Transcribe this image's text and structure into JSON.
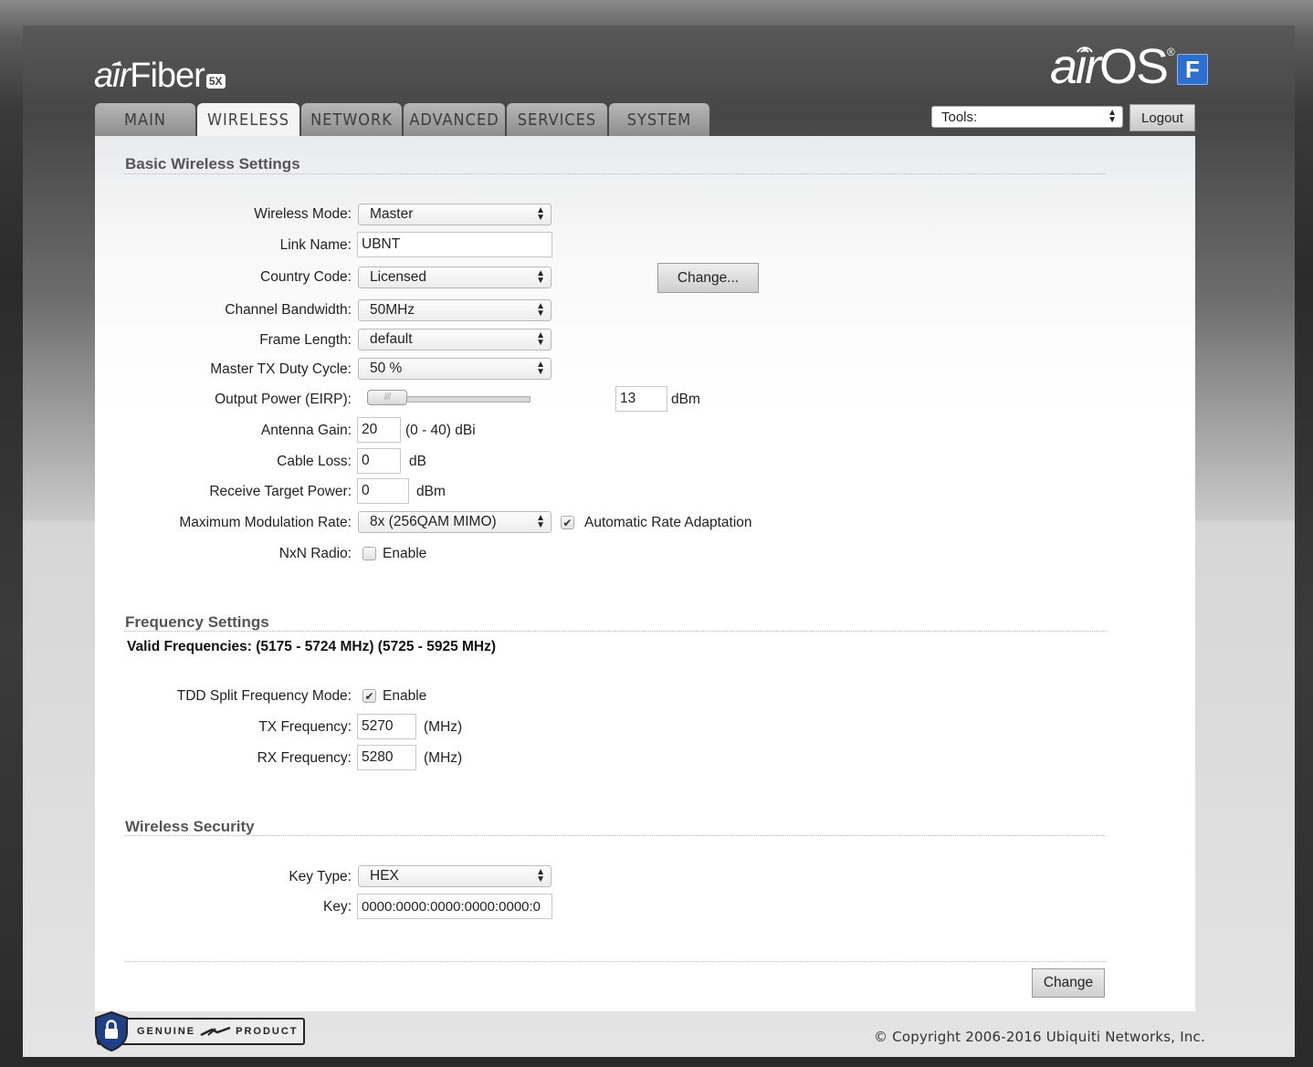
{
  "brand": {
    "product_air": "air",
    "product_name": "Fiber",
    "product_badge": "5X",
    "os_air": "air",
    "os_name": "OS",
    "os_reg": "®",
    "os_badge": "F"
  },
  "tabs": [
    {
      "label": "MAIN"
    },
    {
      "label": "WIRELESS"
    },
    {
      "label": "NETWORK"
    },
    {
      "label": "ADVANCED"
    },
    {
      "label": "SERVICES"
    },
    {
      "label": "SYSTEM"
    }
  ],
  "header": {
    "tools_value": "Tools:",
    "logout_label": "Logout"
  },
  "basic": {
    "title": "Basic Wireless Settings",
    "wireless_mode_label": "Wireless Mode:",
    "wireless_mode_value": "Master",
    "link_name_label": "Link Name:",
    "link_name_value": "UBNT",
    "country_code_label": "Country Code:",
    "country_code_value": "Licensed",
    "change_country_label": "Change...",
    "channel_bw_label": "Channel Bandwidth:",
    "channel_bw_value": "50MHz",
    "frame_length_label": "Frame Length:",
    "frame_length_value": "default",
    "duty_cycle_label": "Master TX Duty Cycle:",
    "duty_cycle_value": "50 %",
    "output_power_label": "Output Power (EIRP):",
    "output_power_value": "13",
    "output_power_unit": "dBm",
    "antenna_gain_label": "Antenna Gain:",
    "antenna_gain_value": "20",
    "antenna_gain_range": "(0 - 40) dBi",
    "cable_loss_label": "Cable Loss:",
    "cable_loss_value": "0",
    "cable_loss_unit": "dB",
    "rx_target_label": "Receive Target Power:",
    "rx_target_value": "0",
    "rx_target_unit": "dBm",
    "max_mod_label": "Maximum Modulation Rate:",
    "max_mod_value": "8x (256QAM MIMO)",
    "auto_rate_label": "Automatic Rate Adaptation",
    "auto_rate_checked": true,
    "nxn_label": "NxN Radio:",
    "nxn_enable_label": "Enable",
    "nxn_checked": false
  },
  "frequency": {
    "title": "Frequency Settings",
    "valid_frequencies": "Valid Frequencies: (5175 - 5724 MHz) (5725 - 5925 MHz)",
    "tdd_label": "TDD Split Frequency Mode:",
    "tdd_enable_label": "Enable",
    "tdd_checked": true,
    "tx_label": "TX Frequency:",
    "tx_value": "5270",
    "tx_unit": "(MHz)",
    "rx_label": "RX Frequency:",
    "rx_value": "5280",
    "rx_unit": "(MHz)"
  },
  "security": {
    "title": "Wireless Security",
    "key_type_label": "Key Type:",
    "key_type_value": "HEX",
    "key_label": "Key:",
    "key_value": "0000:0000:0000:0000:0000:0"
  },
  "footer": {
    "change_label": "Change",
    "genuine_left": "GENUINE",
    "genuine_right": "PRODUCT",
    "copyright": "© Copyright 2006-2016 Ubiquiti Networks, Inc."
  }
}
